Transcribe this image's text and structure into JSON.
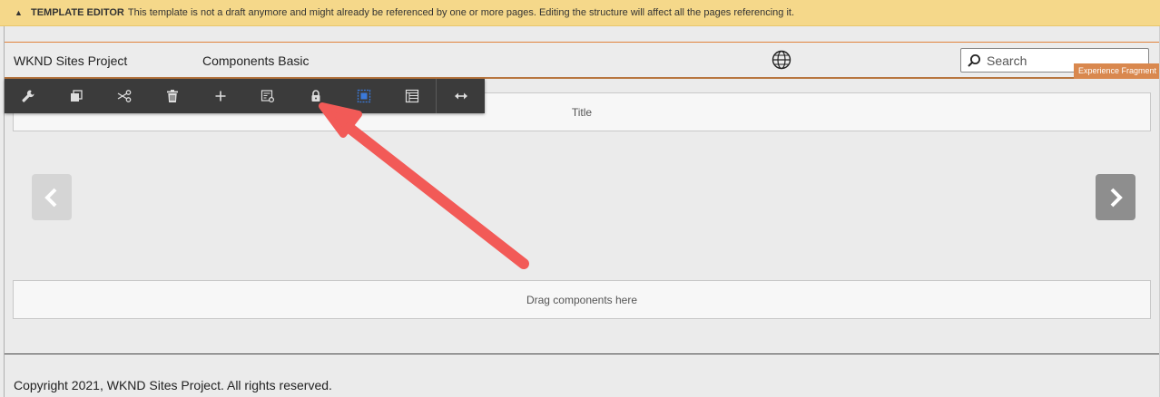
{
  "warning": {
    "icon": "warning-icon",
    "label": "TEMPLATE EDITOR",
    "message": "This template is not a draft anymore and might already be referenced by one or more pages. Editing the structure will affect all the pages referencing it."
  },
  "header": {
    "brand": "WKND Sites Project",
    "nav_item": "Components Basic",
    "globe_icon": "globe-icon",
    "search_placeholder": "Search",
    "xf_tag": "Experience Fragment"
  },
  "toolbar": {
    "buttons": [
      {
        "icon": "wrench-icon",
        "label": "Configure"
      },
      {
        "icon": "copy-icon",
        "label": "Copy"
      },
      {
        "icon": "scissors-icon",
        "label": "Cut"
      },
      {
        "icon": "trash-icon",
        "label": "Delete"
      },
      {
        "icon": "plus-icon",
        "label": "Insert component"
      },
      {
        "icon": "policy-icon",
        "label": "Policy"
      },
      {
        "icon": "lock-icon",
        "label": "Lock structure component"
      },
      {
        "icon": "select-parent-icon",
        "label": "Select parent"
      },
      {
        "icon": "layout-icon",
        "label": "Layout"
      },
      {
        "icon": "resize-icon",
        "label": "Layout mode"
      }
    ]
  },
  "content": {
    "title_placeholder": "Title",
    "drag_placeholder": "Drag components here",
    "prev_icon": "chevron-left-icon",
    "next_icon": "chevron-right-icon"
  },
  "footer": {
    "copyright": "Copyright 2021, WKND Sites Project. All rights reserved."
  },
  "annotation": {
    "color": "#f25a57",
    "points_to": "lock-icon"
  },
  "colors": {
    "warning_bg": "#f5d88a",
    "toolbar_bg": "#3b3b3b",
    "accent_orange": "#e0833d",
    "xf_tag_bg": "#d9884e"
  }
}
